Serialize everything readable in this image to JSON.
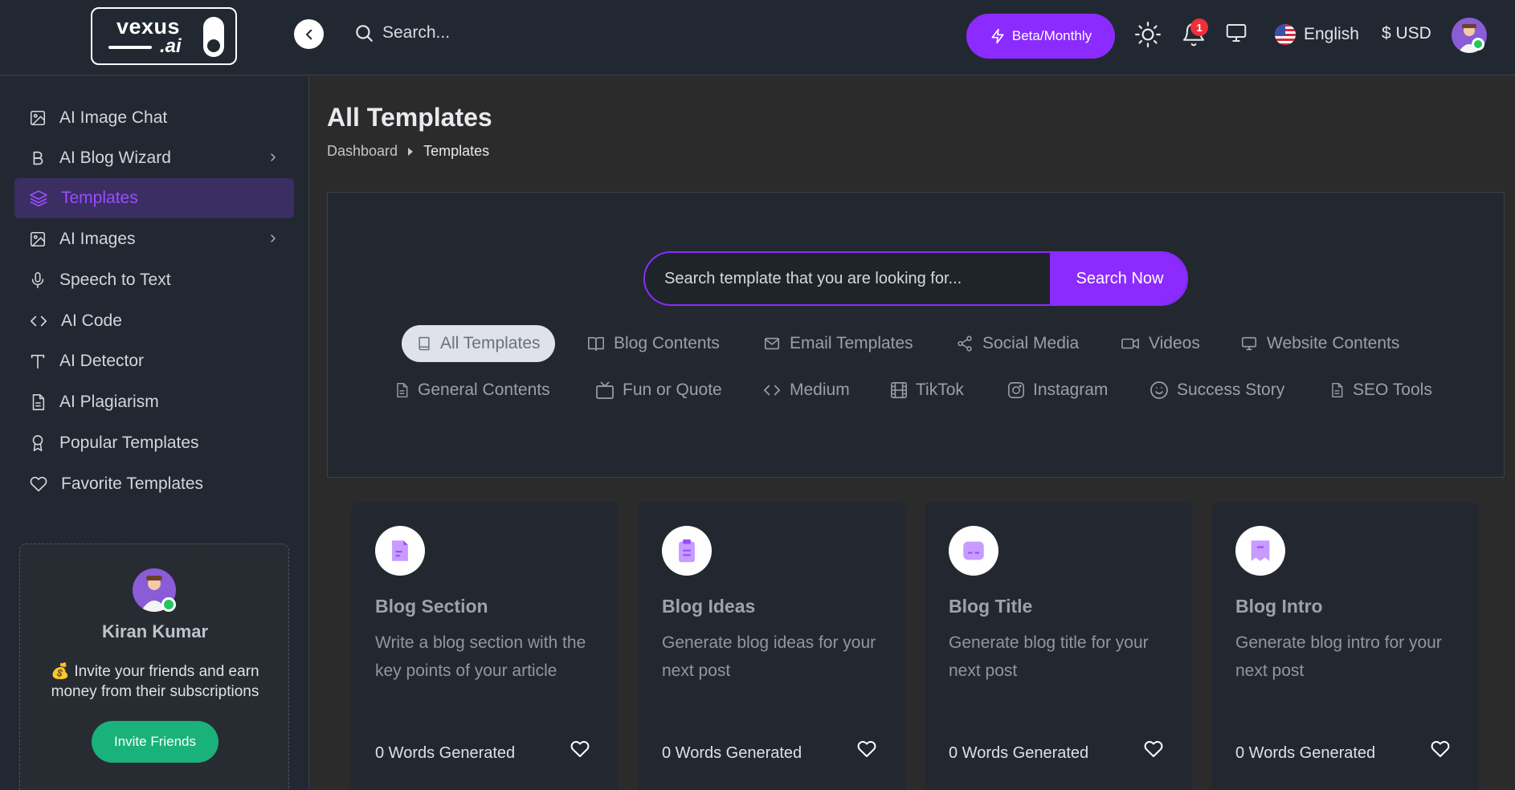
{
  "app": {
    "logo": {
      "line1": "vexus",
      "line2": ".ai"
    },
    "search_label": "Search...",
    "plan_button": "Beta/Monthly",
    "notification_count": "1",
    "language": "English",
    "currency": "$ USD"
  },
  "colors": {
    "accent": "#8b2bff",
    "success": "#19b27a",
    "badge": "#ef2f3a",
    "background": "#2b2b2b",
    "panel": "#232830"
  },
  "sidebar": {
    "items": [
      {
        "label": "AI Image Chat",
        "icon": "image-icon"
      },
      {
        "label": "AI Blog Wizard",
        "icon": "bold-b-icon",
        "has_children": true
      },
      {
        "label": "Templates",
        "icon": "layers-icon",
        "active": true
      },
      {
        "label": "AI Images",
        "icon": "image-icon",
        "has_children": true
      },
      {
        "label": "Speech to Text",
        "icon": "microphone-icon"
      },
      {
        "label": "AI Code",
        "icon": "code-icon"
      },
      {
        "label": "AI Detector",
        "icon": "text-t-icon"
      },
      {
        "label": "AI Plagiarism",
        "icon": "document-icon"
      },
      {
        "label": "Popular Templates",
        "icon": "award-icon"
      },
      {
        "label": "Favorite Templates",
        "icon": "heart-icon"
      }
    ],
    "invite": {
      "name": "Kiran Kumar",
      "text": "💰 Invite your friends and earn money from their subscriptions",
      "button": "Invite Friends"
    }
  },
  "main": {
    "title": "All Templates",
    "breadcrumb": [
      "Dashboard",
      "Templates"
    ],
    "search": {
      "placeholder": "Search template that you are looking for...",
      "button": "Search Now"
    },
    "filters": [
      {
        "label": "All Templates",
        "icon": "book-icon",
        "active": true
      },
      {
        "label": "Blog Contents",
        "icon": "open-book-icon"
      },
      {
        "label": "Email Templates",
        "icon": "mail-icon"
      },
      {
        "label": "Social Media",
        "icon": "share-icon"
      },
      {
        "label": "Videos",
        "icon": "video-icon"
      },
      {
        "label": "Website Contents",
        "icon": "monitor-icon"
      },
      {
        "label": "General Contents",
        "icon": "file-icon"
      },
      {
        "label": "Fun or Quote",
        "icon": "tv-icon"
      },
      {
        "label": "Medium",
        "icon": "code-icon"
      },
      {
        "label": "TikTok",
        "icon": "film-icon"
      },
      {
        "label": "Instagram",
        "icon": "instagram-icon"
      },
      {
        "label": "Success Story",
        "icon": "smile-icon"
      },
      {
        "label": "SEO Tools",
        "icon": "file-icon"
      }
    ],
    "cards": [
      {
        "title": "Blog Section",
        "description": "Write a blog section with the key points of your article",
        "words": "0 Words Generated"
      },
      {
        "title": "Blog Ideas",
        "description": "Generate blog ideas for your next post",
        "words": "0 Words Generated"
      },
      {
        "title": "Blog Title",
        "description": "Generate blog title for your next post",
        "words": "0 Words Generated"
      },
      {
        "title": "Blog Intro",
        "description": "Generate blog intro for your next post",
        "words": "0 Words Generated"
      }
    ]
  }
}
